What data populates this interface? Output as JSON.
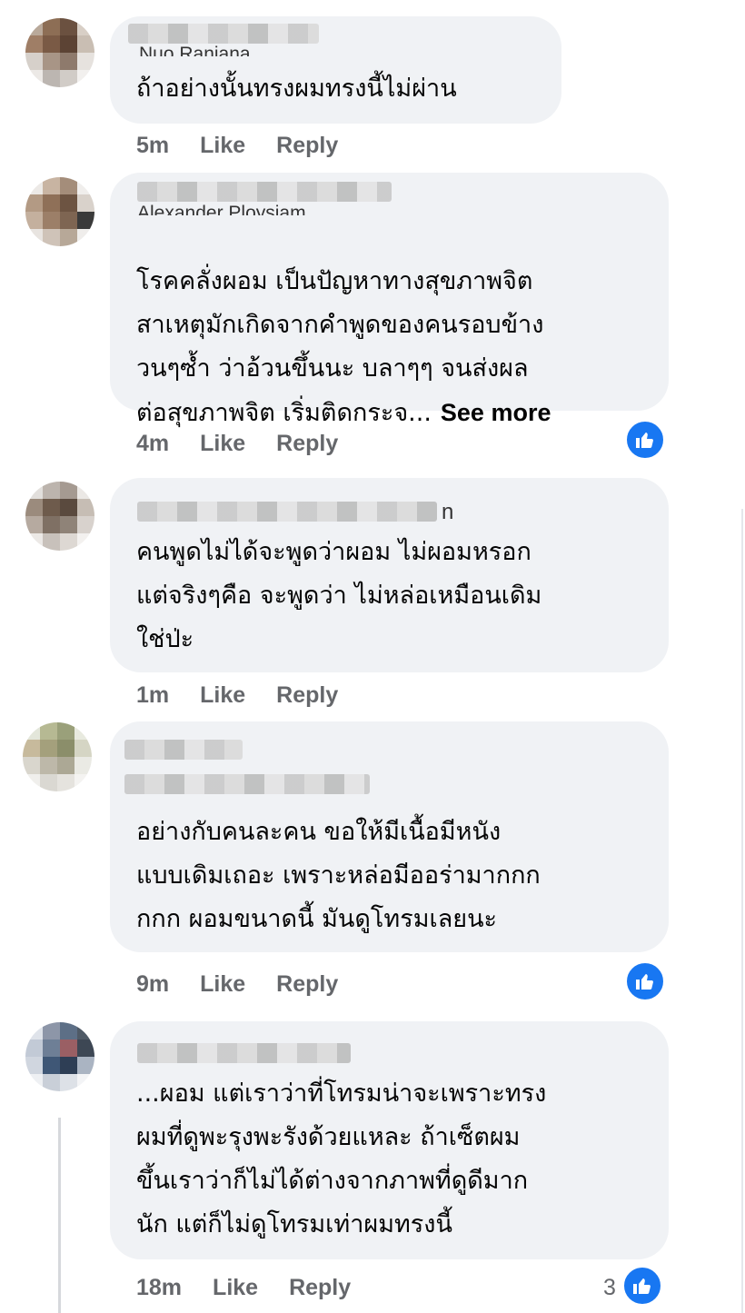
{
  "comments": [
    {
      "name_visible": "Nuo Ranjana",
      "text": "ถ้าอย่างนั้นทรงผมทรงนี้ไม่ผ่าน",
      "time": "5m",
      "like": "Like",
      "reply": "Reply"
    },
    {
      "name_visible": "Alexander Ploysiam",
      "text": "โรคคลั่งผอม เป็นปัญหาทางสุขภาพจิต\nสาเหตุมักเกิดจากคำพูดของคนรอบข้าง\nวนๆซ้ำ ว่าอ้วนขึ้นนะ บลาๆๆ จนส่งผล\nต่อสุขภาพจิต เริ่มติดกระจ...",
      "see_more": "See more",
      "time": "4m",
      "like": "Like",
      "reply": "Reply"
    },
    {
      "name_visible": "n",
      "text": "คนพูดไม่ได้จะพูดว่าผอม ไม่ผอมหรอก\nแต่จริงๆคือ จะพูดว่า ไม่หล่อเหมือนเดิม\nใช่ป่ะ",
      "time": "1m",
      "like": "Like",
      "reply": "Reply"
    },
    {
      "text": "อย่างกับคนละคน ขอให้มีเนื้อมีหนัง\nแบบเดิมเถอะ เพราะหล่อมีออร่ามากกก\nกกก ผอมขนาดนี้ มันดูโทรมเลยนะ",
      "time": "9m",
      "like": "Like",
      "reply": "Reply"
    },
    {
      "text": "...ผอม แต่เราว่าที่โทรมน่าจะเพราะทรง\nผมที่ดูพะรุงพะรังด้วยแหละ ถ้าเซ็ตผม\nขึ้นเราว่าก็ไม่ได้ต่างจากภาพที่ดูดีมาก\nนัก แต่ก็ไม่ดูโทรมเท่าผมทรงนี้",
      "time": "18m",
      "like": "Like",
      "reply": "Reply",
      "reaction_count": "3"
    }
  ],
  "colors": {
    "bubble": "#f0f2f5",
    "meta": "#65676b",
    "like_blue": "#1877f2"
  },
  "icons": {
    "reaction": "thumbs-up-icon"
  }
}
